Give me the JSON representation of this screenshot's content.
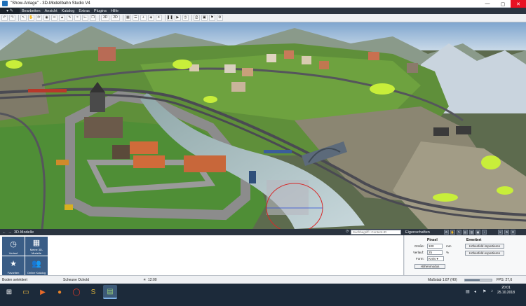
{
  "window": {
    "title": "\"Show-Anlage\" - 3D-Modellbahn Studio V4",
    "minimize": "—",
    "maximize": "▢",
    "close": "✕"
  },
  "menu": {
    "items": [
      "Bearbeiten",
      "Ansicht",
      "Katalog",
      "Extras",
      "Plugins",
      "Hilfe"
    ]
  },
  "toolbar": {
    "view3d": "3D",
    "view2d": "2D"
  },
  "panels": {
    "models": {
      "title": "3D-Modelle",
      "search_placeholder": "Suchbegriff / Content-ID",
      "tiles": [
        {
          "label": "Verlauf",
          "icon": "clock-icon"
        },
        {
          "label": "Meine 3D-Modelle",
          "icon": "grid-icon"
        },
        {
          "label": "Favoriten",
          "icon": "star-icon"
        },
        {
          "label": "Online Katalog",
          "icon": "people-icon"
        }
      ]
    },
    "properties": {
      "title": "Eigenschaften",
      "brush_title": "Pinsel",
      "size_label": "Größe:",
      "size_value": "100",
      "size_unit": "mm",
      "falloff_label": "Verlauf:",
      "falloff_value": "25",
      "falloff_unit": "%",
      "shape_label": "Form:",
      "shape_value": "Kreis",
      "height_mode_button": "Höhenmodus",
      "advanced_title": "Erweitert",
      "import_button": "Höhenfeld importieren",
      "export_button": "Höhenfeld exportieren"
    }
  },
  "status": {
    "left": "Boden selektiert",
    "center": "Scheune Ochold",
    "time": "12:00",
    "scale": "Maßstab 1:87 (H0)",
    "fps": "FPS: 27,6",
    "zoom_fraction": 0.55
  },
  "taskbar": {
    "clock_time": "20:01",
    "clock_date": "25.10.2018"
  },
  "colors": {
    "accent": "#2b3440",
    "tile": "#3a5d86",
    "close": "#e81123"
  }
}
